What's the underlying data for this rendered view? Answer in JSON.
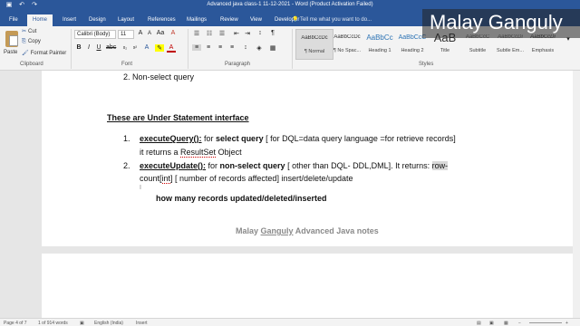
{
  "titlebar": {
    "title": "Advanced java class-1  11-12-2021 - Word (Product Activation Failed)"
  },
  "tabs": [
    "File",
    "Home",
    "Insert",
    "Design",
    "Layout",
    "References",
    "Mailings",
    "Review",
    "View",
    "Developer"
  ],
  "tell_me": "Tell me what you want to do...",
  "overlay_name": "Malay Ganguly",
  "ribbon": {
    "clipboard": {
      "paste": "Paste",
      "cut": "Cut",
      "copy": "Copy",
      "format_painter": "Format Painter",
      "label": "Clipboard"
    },
    "font": {
      "name": "Calibri (Body)",
      "size": "11",
      "label": "Font"
    },
    "paragraph_label": "Paragraph",
    "styles_label": "Styles",
    "styles": [
      {
        "sample": "AaBbCcDc",
        "name": "¶ Normal"
      },
      {
        "sample": "AaBbCcDc",
        "name": "¶ No Spac..."
      },
      {
        "sample": "AaBbCc",
        "name": "Heading 1"
      },
      {
        "sample": "AaBbCcC",
        "name": "Heading 2"
      },
      {
        "sample": "AaB",
        "name": "Title"
      },
      {
        "sample": "AaBbCcC",
        "name": "Subtitle"
      },
      {
        "sample": "AaBbCcDi",
        "name": "Subtle Em..."
      },
      {
        "sample": "AaBbCcDi",
        "name": "Emphasis"
      }
    ]
  },
  "document": {
    "prev_item": "2.  Non-select query",
    "heading": "These are Under Statement interface",
    "item1": {
      "num": "1.",
      "method": "executeQuery():",
      "t1": " for ",
      "t2": "select query",
      "t3": " [ for DQL=data query language =for retrieve records]",
      "line2a": "it returns a ",
      "line2b": "ResultSet",
      "line2c": " Object"
    },
    "item2": {
      "num": "2.",
      "method": "executeUpdate():",
      "t1": " for ",
      "t2": "non-select query",
      "t3": " [ other than DQL-  DDL,DML]. It returns: ",
      "t4": "row-",
      "line2a": "count[",
      "line2b": "int",
      "line2c": "]  [ number of records affected] insert/delete/update"
    },
    "bold_note": "how many records updated/deleted/inserted",
    "footer_note_pre": "Malay ",
    "footer_note_name": "Ganguly",
    "footer_note_post": " Advanced Java notes"
  },
  "statusbar": {
    "page": "Page 4 of 7",
    "words": "1 of 914 words",
    "language": "English (India)",
    "mode": "Insert"
  }
}
